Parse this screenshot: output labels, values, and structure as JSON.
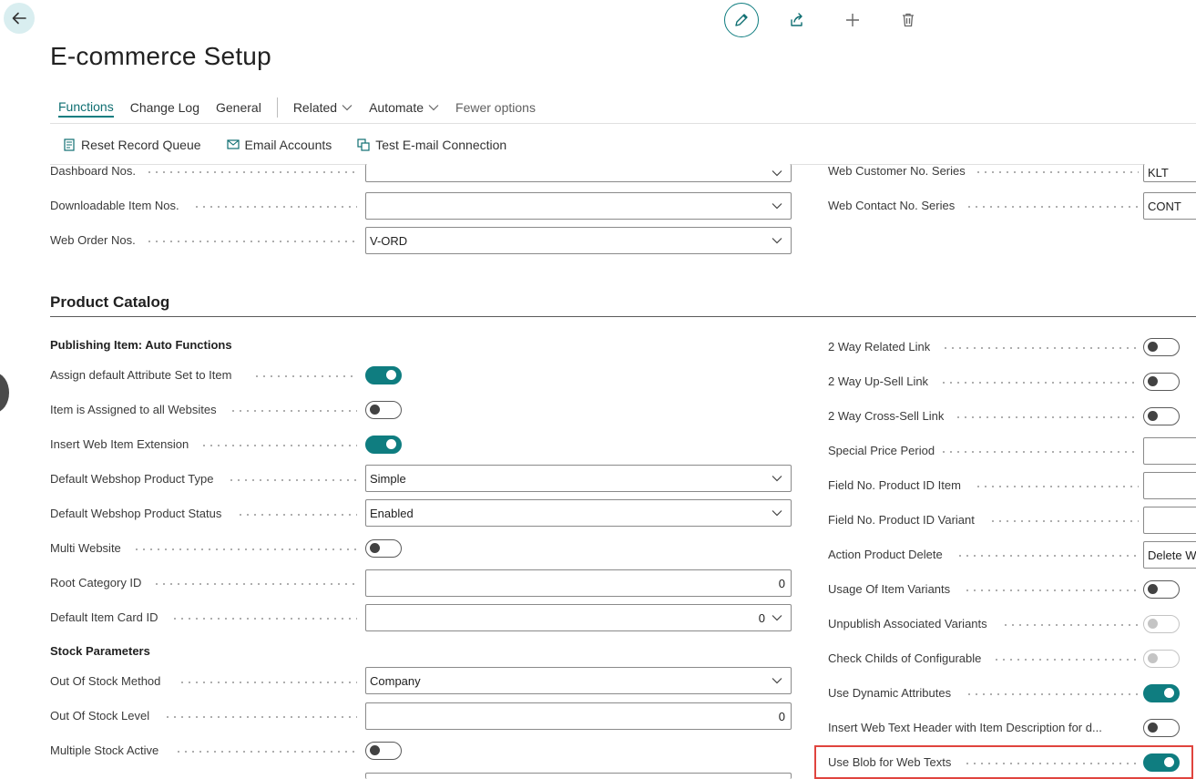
{
  "header": {
    "title": "E-commerce Setup"
  },
  "menu": {
    "items": [
      {
        "label": "Functions"
      },
      {
        "label": "Change Log"
      },
      {
        "label": "General"
      },
      {
        "label": "Related"
      },
      {
        "label": "Automate"
      },
      {
        "label": "Fewer options"
      }
    ]
  },
  "toolbar": {
    "reset": "Reset Record Queue",
    "email": "Email Accounts",
    "test": "Test E-mail Connection"
  },
  "numbers": {
    "dashboard": {
      "label": "Dashboard Nos.",
      "value": ""
    },
    "downloadable": {
      "label": "Downloadable Item Nos.",
      "value": ""
    },
    "web_order": {
      "label": "Web Order Nos.",
      "value": "V-ORD"
    },
    "web_customer": {
      "label": "Web Customer No. Series",
      "value": "KLT"
    },
    "web_contact": {
      "label": "Web Contact No. Series",
      "value": "CONT"
    }
  },
  "catalog": {
    "title": "Product Catalog",
    "group1": "Publishing Item: Auto Functions",
    "assign_default": {
      "label": "Assign default Attribute Set to Item",
      "on": true
    },
    "assigned_all": {
      "label": "Item is Assigned to all Websites",
      "on": false
    },
    "insert_ext": {
      "label": "Insert Web Item Extension",
      "on": true
    },
    "product_type": {
      "label": "Default Webshop Product Type",
      "value": "Simple"
    },
    "product_status": {
      "label": "Default Webshop Product Status",
      "value": "Enabled"
    },
    "multi_website": {
      "label": "Multi Website",
      "on": false
    },
    "root_category": {
      "label": "Root Category ID",
      "value": "0"
    },
    "item_card": {
      "label": "Default Item Card ID",
      "value": "0"
    },
    "group2": "Stock Parameters",
    "oos_method": {
      "label": "Out Of Stock Method",
      "value": "Company"
    },
    "oos_level": {
      "label": "Out Of Stock Level",
      "value": "0"
    },
    "multi_stock": {
      "label": "Multiple Stock Active",
      "on": false
    },
    "right": {
      "related": {
        "label": "2 Way Related Link",
        "on": false
      },
      "upsell": {
        "label": "2 Way Up-Sell Link",
        "on": false
      },
      "crosssell": {
        "label": "2 Way Cross-Sell Link",
        "on": false
      },
      "special_price": {
        "label": "Special Price Period",
        "value": ""
      },
      "field_item": {
        "label": "Field No. Product ID Item",
        "value": ""
      },
      "field_variant": {
        "label": "Field No. Product ID Variant",
        "value": ""
      },
      "action_delete": {
        "label": "Action Product Delete",
        "value": "Delete W"
      },
      "usage_variants": {
        "label": "Usage Of Item Variants",
        "on": false
      },
      "unpublish": {
        "label": "Unpublish Associated Variants",
        "on": false
      },
      "check_childs": {
        "label": "Check Childs of Configurable",
        "on": false
      },
      "dynamic_attr": {
        "label": "Use Dynamic Attributes",
        "on": true
      },
      "insert_header": {
        "label": "Insert Web Text Header with Item Description for d...",
        "on": false
      },
      "use_blob": {
        "label": "Use Blob for Web Texts",
        "on": true
      }
    }
  }
}
